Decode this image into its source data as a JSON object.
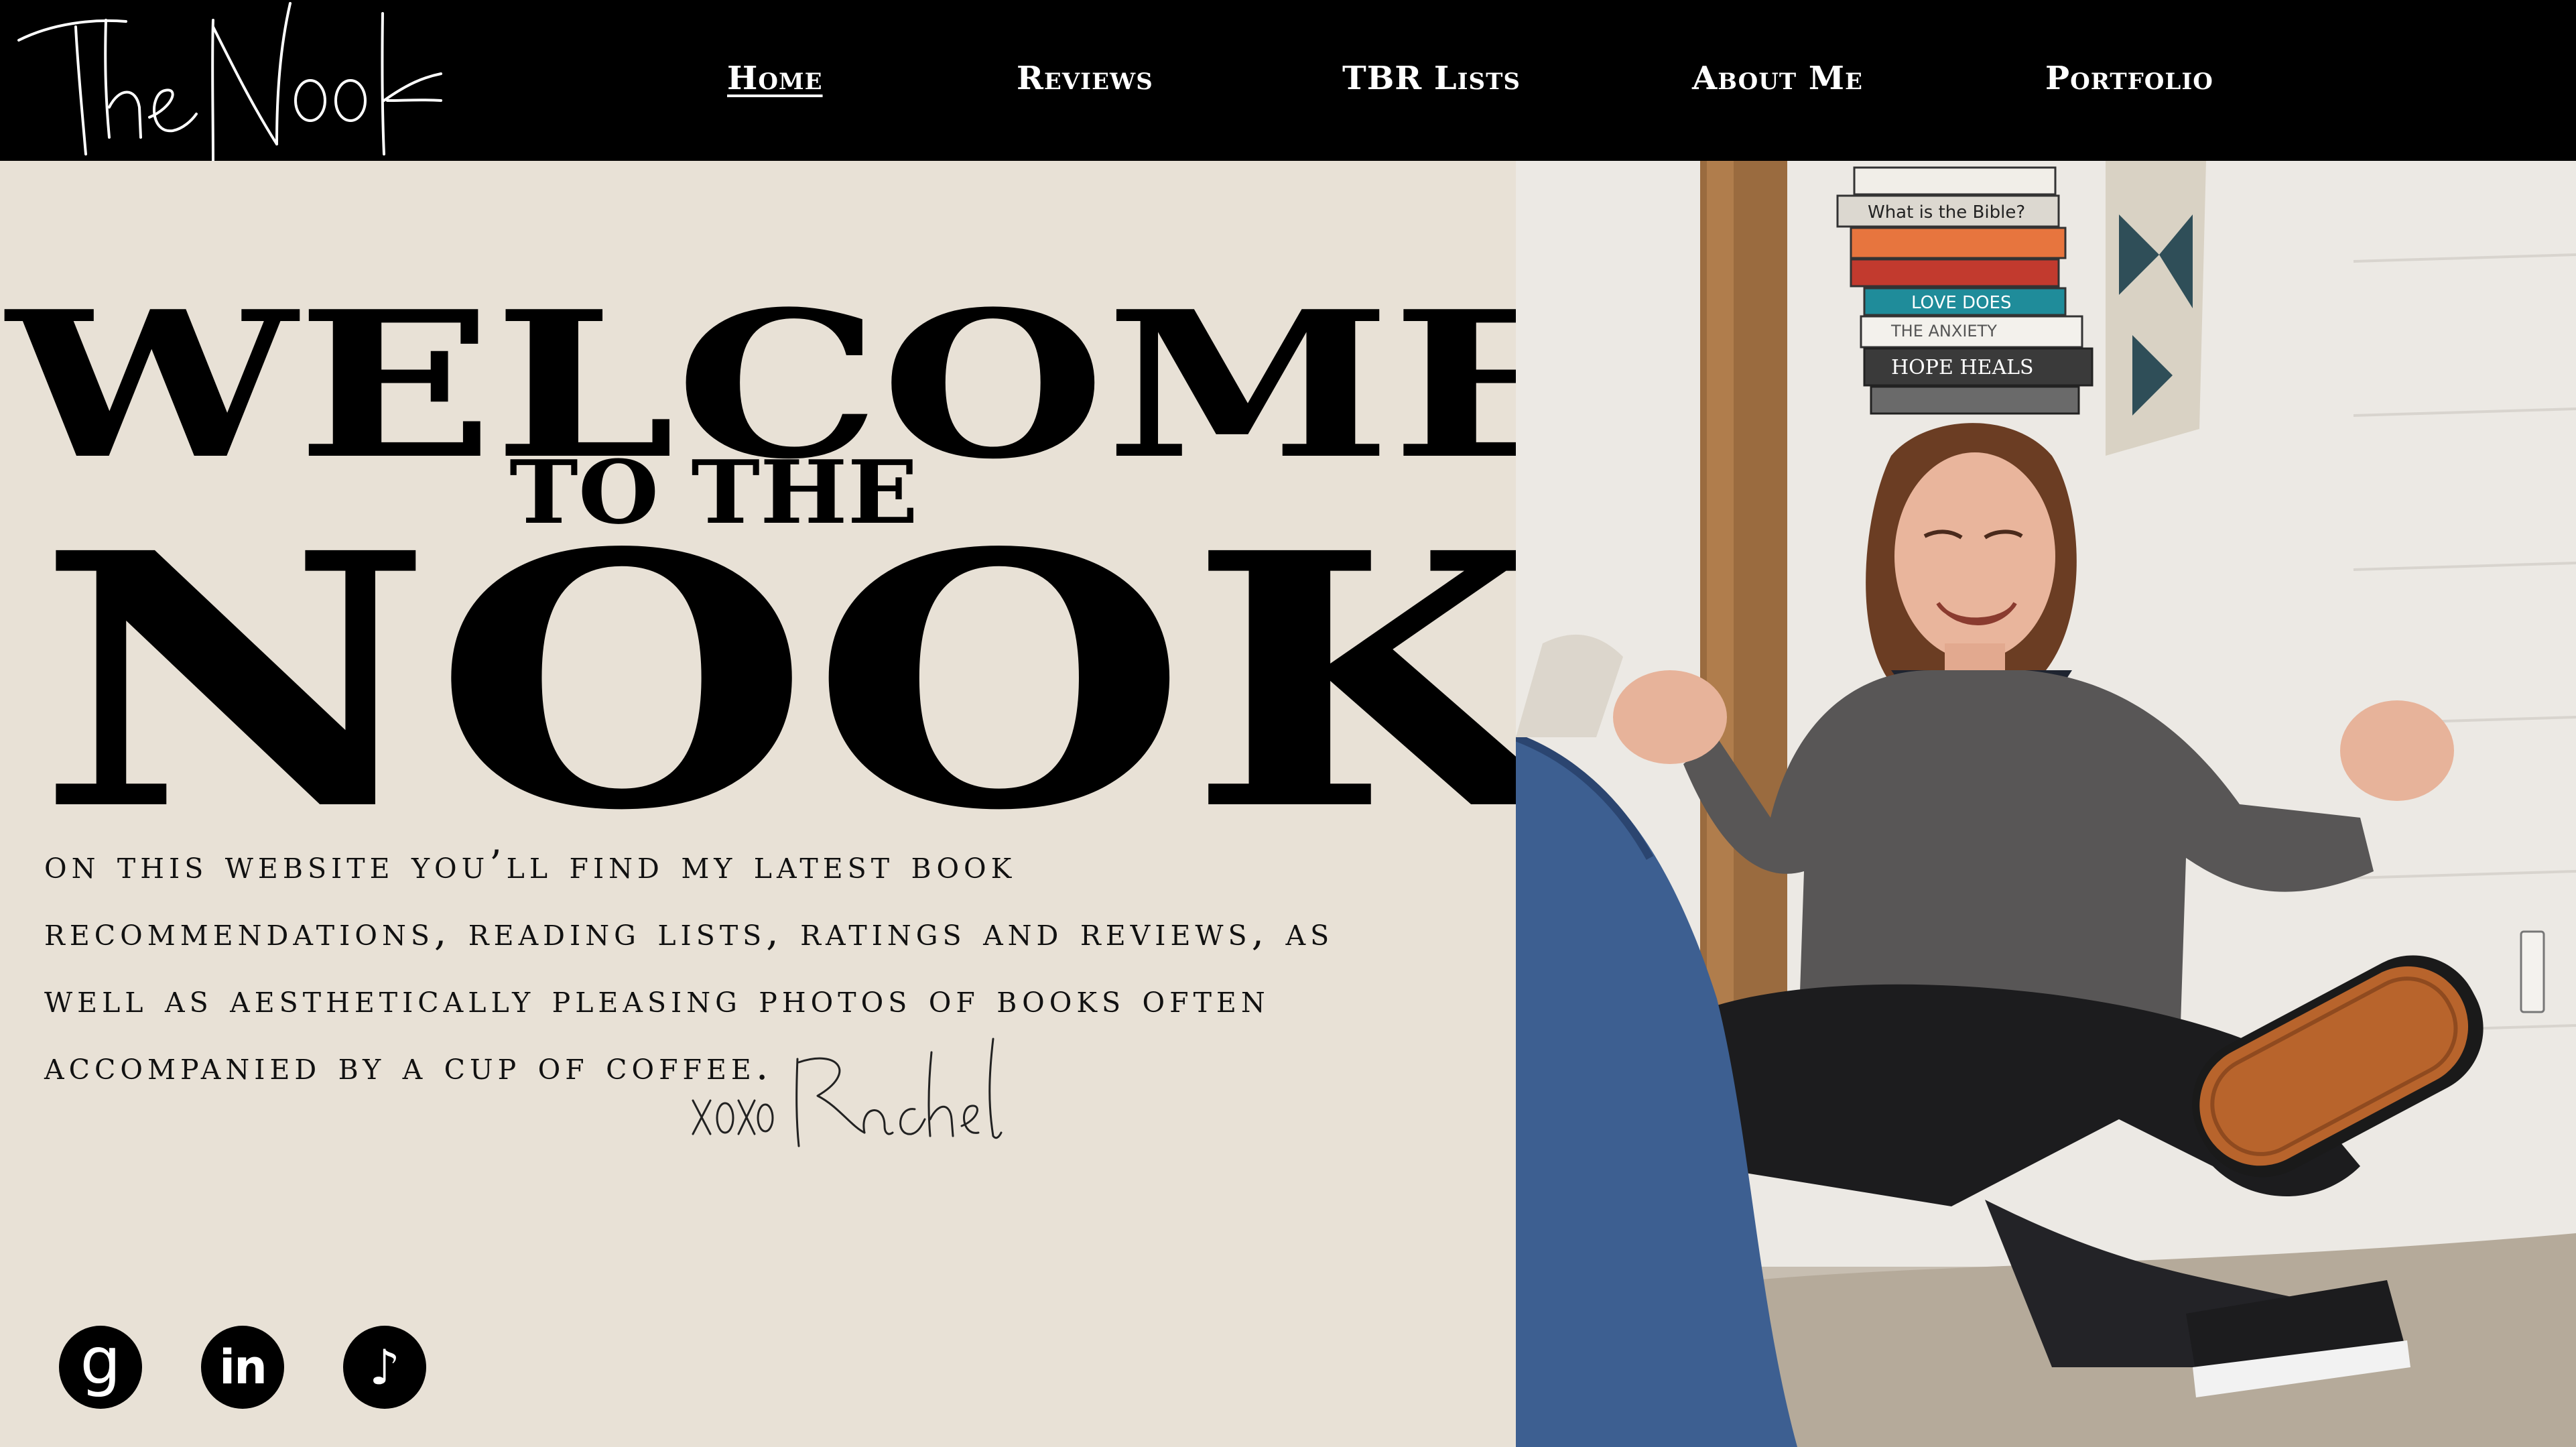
{
  "header": {
    "logo_text": "The Nook",
    "nav": [
      {
        "label": "Home",
        "active": true
      },
      {
        "label": "Reviews",
        "active": false
      },
      {
        "label": "TBR Lists",
        "active": false
      },
      {
        "label": "About Me",
        "active": false
      },
      {
        "label": "Portfolio",
        "active": false
      }
    ]
  },
  "hero": {
    "line1": "WELCOME",
    "line2": "TO THE",
    "line3": "NOOK"
  },
  "intro": {
    "lines": [
      "on this website you’ll find my latest book",
      "recommendations, reading lists, ratings and reviews, as",
      "well as aesthetically pleasing photos of books often",
      "accompanied by a cup of coffee."
    ],
    "signature": "xoxo Rachel"
  },
  "social": [
    {
      "name": "goodreads",
      "glyph": "g"
    },
    {
      "name": "linkedin",
      "glyph": "in"
    },
    {
      "name": "tiktok",
      "glyph": "♪"
    }
  ],
  "photo": {
    "book_spines": [
      "What is the Bible?",
      "HOPE HEALS",
      "LOVE DOES",
      "THE ANXIETY"
    ]
  },
  "colors": {
    "header_bg": "#000000",
    "panel_bg": "#e8e1d6",
    "text": "#000000"
  }
}
